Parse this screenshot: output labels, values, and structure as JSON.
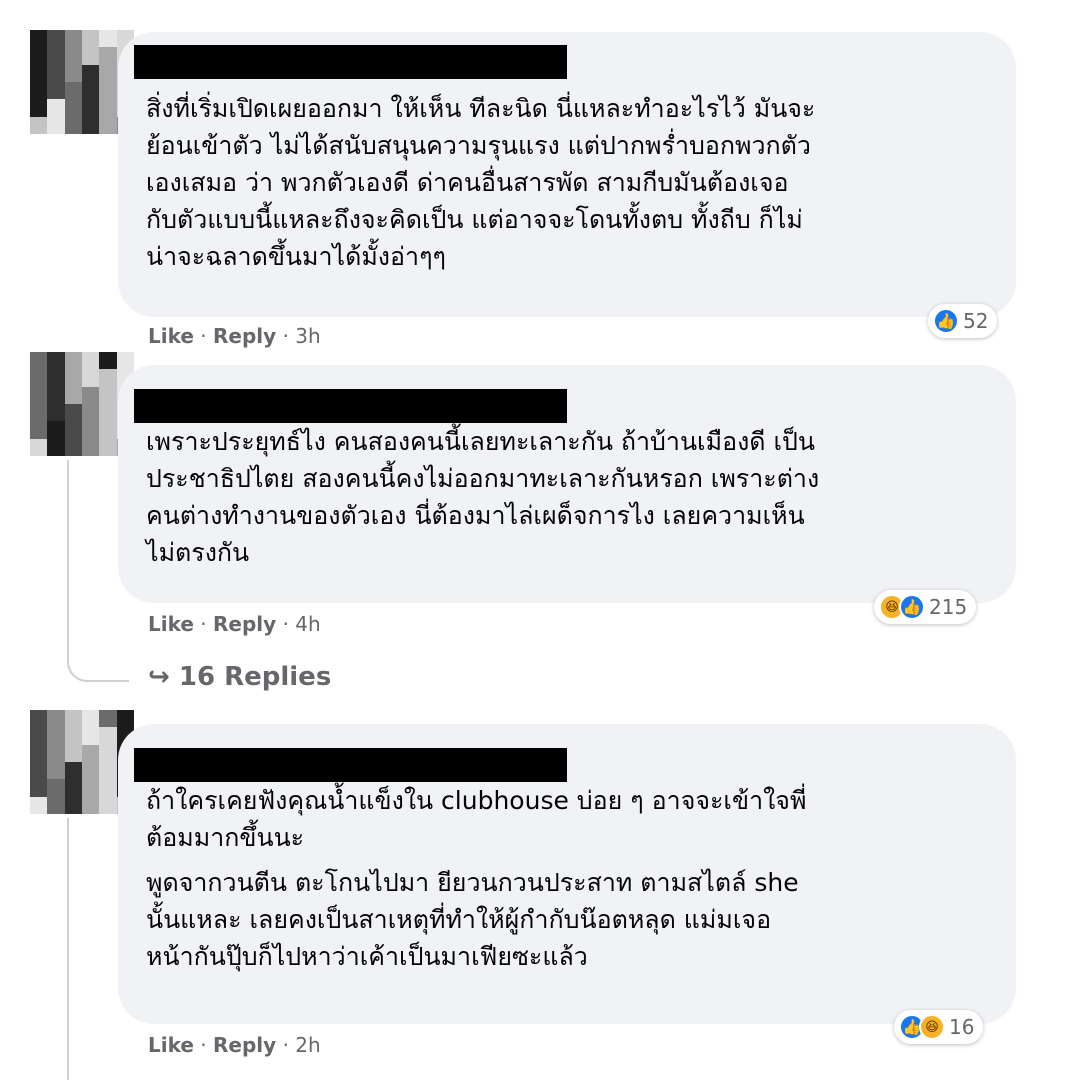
{
  "comments": [
    {
      "text": "สิ่งที่เริ่มเปิดเผยออกมา ให้เห็น ทีละนิด นี่แหละทำอะไรไว้ มันจะ\nย้อนเข้าตัว ไม่ได้สนับสนุนความรุนแรง แต่ปากพร่ำบอกพวกตัว\nเองเสมอ ว่า พวกตัวเองดี ด่าคนอื่นสารพัด สามกีบมันต้องเจอ\nกับตัวแบบนี้แหละถึงจะคิดเป็น แต่อาจจะโดนทั้งตบ ทั้งถีบ ก็ไม่\nน่าจะฉลาดขึ้นมาได้มั้งอ่าๆๆ",
      "like_label": "Like",
      "reply_label": "Reply",
      "time": "3h",
      "reaction_count": "52",
      "reactions": [
        "like-icon"
      ]
    },
    {
      "text": "เพราะประยุทธ์ไง คนสองคนนี้เลยทะเลาะกัน ถ้าบ้านเมืองดี เป็น\nประชาธิปไตย สองคนนี้คงไม่ออกมาทะเลาะกันหรอก เพราะต่าง\nคนต่างทำงานของตัวเอง นี่ต้องมาไล่เผด็จการไง เลยความเห็น\nไม่ตรงกัน",
      "like_label": "Like",
      "reply_label": "Reply",
      "time": "4h",
      "reaction_count": "215",
      "reactions": [
        "haha-icon",
        "like-icon"
      ],
      "replies_label": "16 Replies"
    },
    {
      "text": "ถ้าใครเคยฟังคุณน้ำแข็งใน clubhouse บ่อย ๆ อาจจะเข้าใจพี่\nต้อมมากขึ้นนะ",
      "text2": "พูดจากวนตีน ตะโกนไปมา ยียวนกวนประสาท ตามสไตล์ she\nนั้นแหละ เลยคงเป็นสาเหตุที่ทำให้ผู้กำกับน๊อตหลุด แม่มเจอ\nหน้ากันปุ๊บก็ไปหาว่าเค้าเป็นมาเฟียซะแล้ว",
      "like_label": "Like",
      "reply_label": "Reply",
      "time": "2h",
      "reaction_count": "16",
      "reactions": [
        "like-icon",
        "haha-icon"
      ]
    }
  ],
  "separator": "·",
  "reply_arrow": "↪",
  "colors": {
    "bubble": "#f0f2f5",
    "like_blue": "#1877f2",
    "haha_yellow": "#f7b125",
    "meta_gray": "#65676b"
  }
}
